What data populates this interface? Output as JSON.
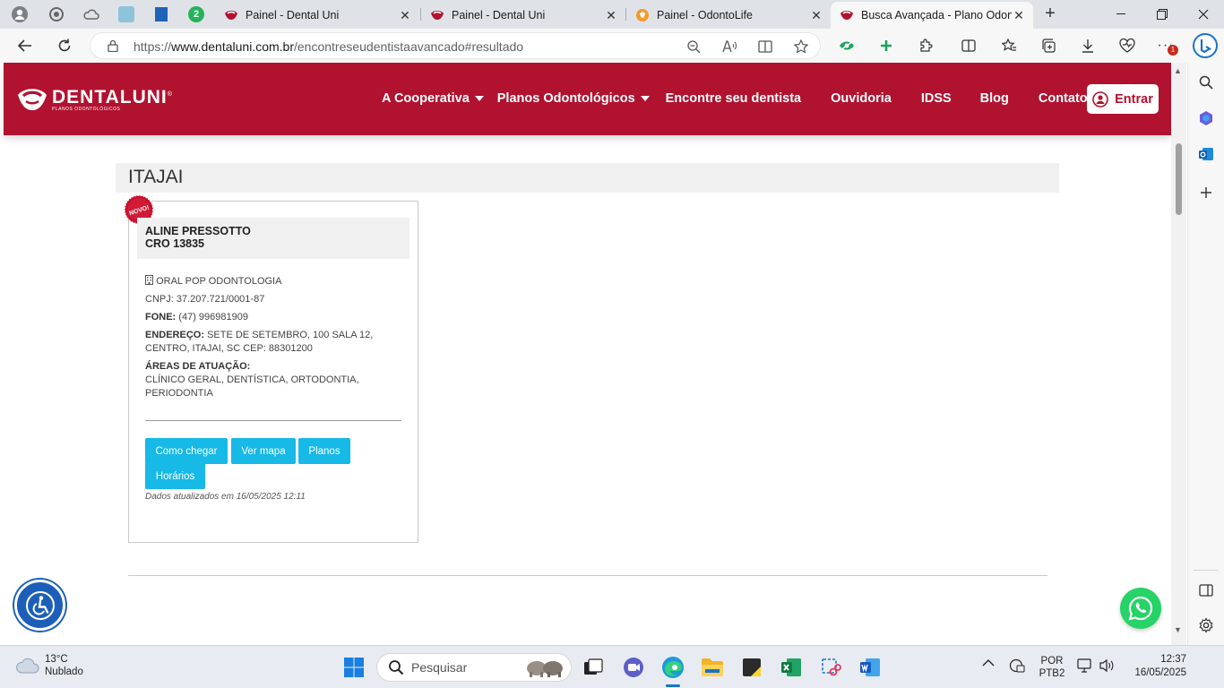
{
  "browser": {
    "tabs": [
      {
        "title": "Painel - Dental Uni",
        "active": false
      },
      {
        "title": "Painel - Dental Uni",
        "active": false
      },
      {
        "title": "Painel - OdontoLife",
        "active": false
      },
      {
        "title": "Busca Avançada - Plano Odont",
        "active": true
      }
    ],
    "pinned_badge": "2",
    "url_prefix": "https://",
    "url_host": "www.dentaluni.com.br",
    "url_path": "/encontreseudentistaavancado#resultado",
    "menu_badge": "1"
  },
  "site": {
    "logo_name": "DENTALUNI",
    "logo_reg": "®",
    "logo_tagline": "PLANOS ODONTOLÓGICOS",
    "nav": [
      {
        "label": "A Cooperativa",
        "dropdown": true
      },
      {
        "label": "Planos Odontológicos",
        "dropdown": true
      },
      {
        "label": "Encontre seu dentista",
        "dropdown": false
      },
      {
        "label": "Ouvidoria",
        "dropdown": false
      },
      {
        "label": "IDSS",
        "dropdown": false
      },
      {
        "label": "Blog",
        "dropdown": false
      },
      {
        "label": "Contato",
        "dropdown": false
      }
    ],
    "login_label": "Entrar",
    "brand_color": "#b1122f",
    "accent_color": "#17b9e6"
  },
  "results": {
    "city": "ITAJAI",
    "card": {
      "badge": "NOVO!",
      "name": "ALINE PRESSOTTO",
      "cro": "CRO 13835",
      "clinic_icon": "building-icon",
      "clinic": "ORAL POP ODONTOLOGIA",
      "cnpj": "CNPJ: 37.207.721/0001-87",
      "phone_label": "FONE:",
      "phone": "(47) 996981909",
      "address_label": "ENDEREÇO:",
      "address": "SETE DE SETEMBRO, 100 SALA 12, CENTRO, ITAJAI, SC CEP: 88301200",
      "areas_label": "ÁREAS DE ATUAÇÃO:",
      "areas": "CLÍNICO GERAL, DENTÍSTICA, ORTODONTIA, PERIODONTIA",
      "buttons": [
        "Como chegar",
        "Ver mapa",
        "Planos",
        "Horários"
      ],
      "updated": "Dados atualizados em 16/05/2025 12:11"
    }
  },
  "taskbar": {
    "weather_temp": "13°C",
    "weather_desc": "Nublado",
    "search_placeholder": "Pesquisar",
    "lang_top": "POR",
    "lang_bottom": "PTB2",
    "time": "12:37",
    "date": "16/05/2025"
  }
}
